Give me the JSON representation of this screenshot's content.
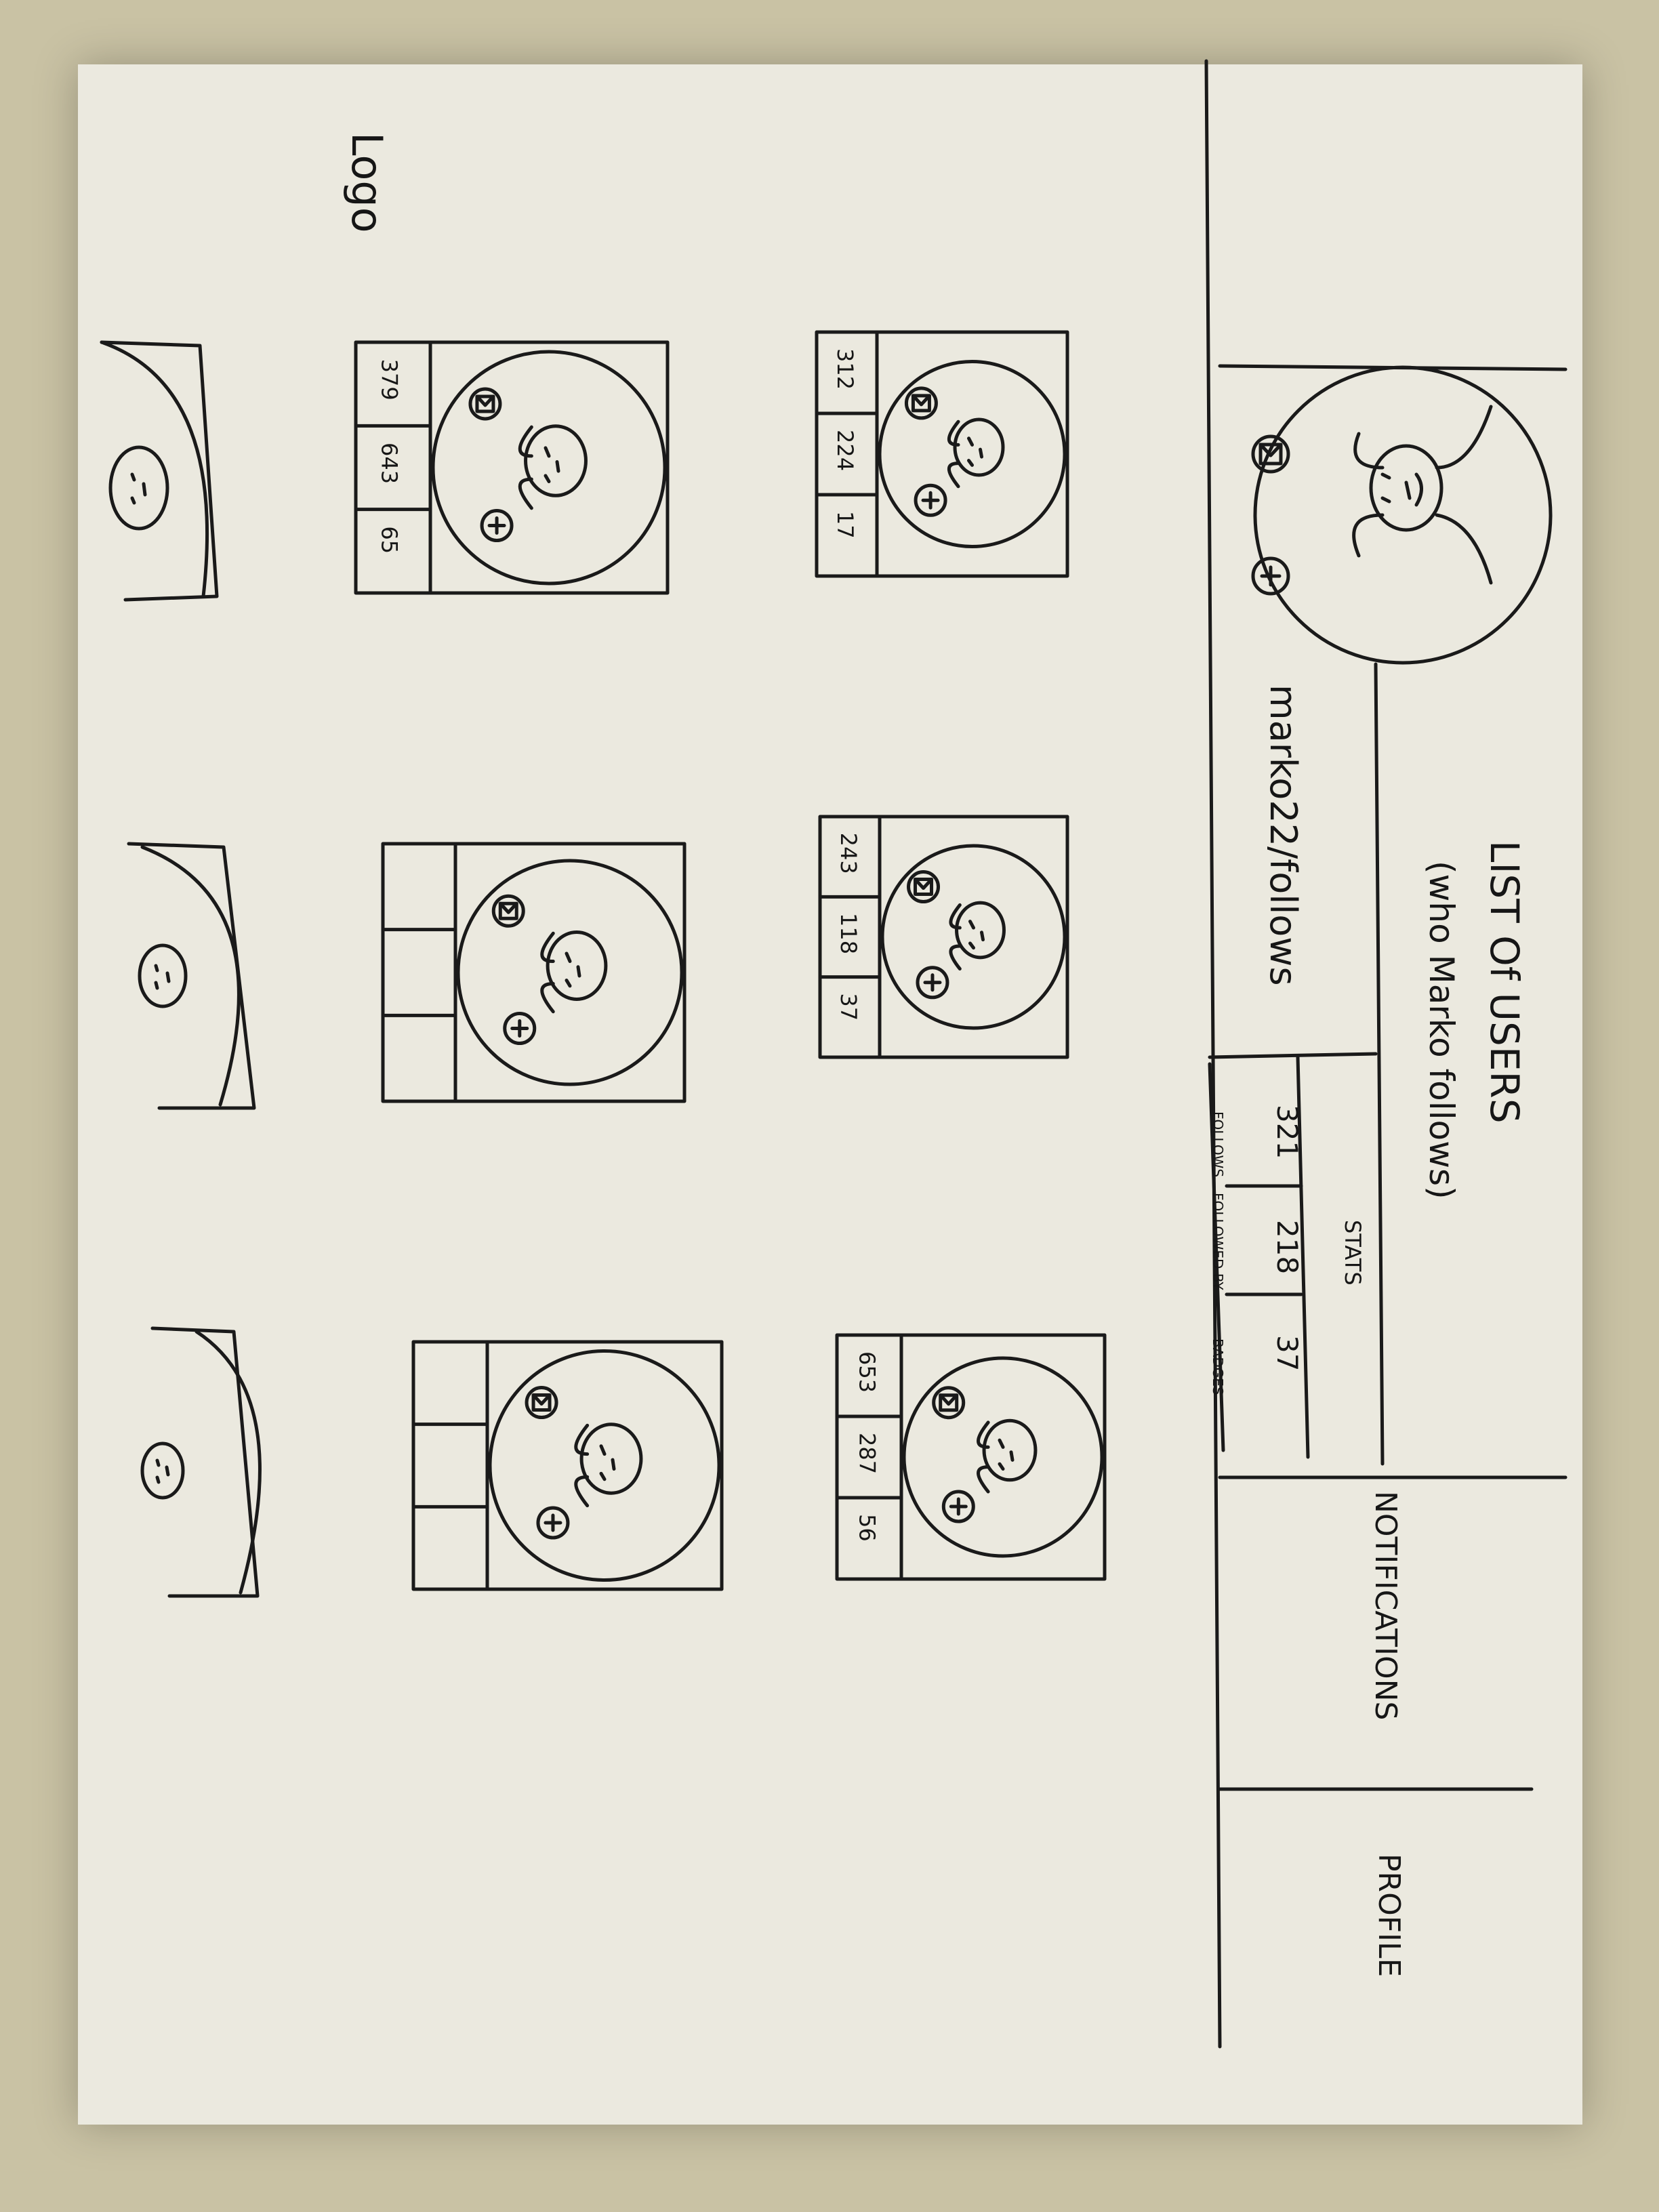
{
  "header": {
    "logo": "Logo",
    "title_line1": "LIST Of USERS",
    "title_line2": "(who Marko follows)",
    "nav": [
      "NOTIFICATIONS",
      "PROFILE"
    ]
  },
  "profile": {
    "handle": "marko22/follows",
    "stats_title": "STATS",
    "stats": [
      {
        "label": "FOLLOWS",
        "value": "321"
      },
      {
        "label": "FOLLOWED BY",
        "value": "218"
      },
      {
        "label": "BADGES",
        "value": "37"
      }
    ]
  },
  "user_cards": [
    {
      "stats": [
        "312",
        "224",
        "17"
      ]
    },
    {
      "stats": [
        "243",
        "118",
        "37"
      ]
    },
    {
      "stats": [
        "653",
        "287",
        "56"
      ]
    },
    {
      "stats": [
        "379",
        "643",
        "65"
      ]
    },
    {
      "stats": [
        "",
        "",
        ""
      ]
    },
    {
      "stats": [
        "",
        "",
        ""
      ]
    }
  ],
  "icons": {
    "message": "message-icon",
    "follow": "follow-plus-icon"
  },
  "colors": {
    "ink": "#1a1a1a",
    "paper": "#ebe9df",
    "background": "#c9c2a4"
  }
}
